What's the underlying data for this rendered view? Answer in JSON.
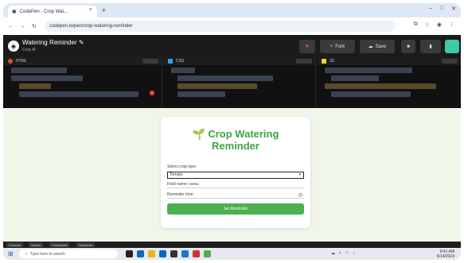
{
  "browser": {
    "tab_title": "CodePen - Crop Wat...",
    "url": "codepen.io/pen/crop-watering-reminder",
    "tab_close": "×",
    "new_tab": "+"
  },
  "header": {
    "title": "Watering Reminder",
    "subtitle": "Crop AI",
    "fork_label": "Fork",
    "save_label": "Save"
  },
  "editors": {
    "html_label": "HTML",
    "css_label": "CSS",
    "js_label": "JS"
  },
  "card": {
    "icon": "🌱",
    "title_line1": "Crop Watering",
    "title_line2": "Reminder",
    "crop_label": "Select crop type:",
    "crop_value": "Tomato",
    "field_label": "Field name / area:",
    "field_value": "",
    "time_label": "Reminder time:",
    "time_value": "",
    "submit_label": "Set Reminder"
  },
  "statusbar": {
    "console": "Console",
    "assets": "Assets",
    "comments": "Comments",
    "shortcuts": "Shortcuts"
  },
  "taskbar": {
    "search_placeholder": "Type here to search",
    "time": "9:41 AM",
    "date": "5/14/2024"
  },
  "colors": {
    "accent": "#4caf50",
    "title": "#3da542",
    "preview_bg": "#f1f6ea",
    "editor_bg": "#111111",
    "header_bg": "#1b1b1b"
  }
}
